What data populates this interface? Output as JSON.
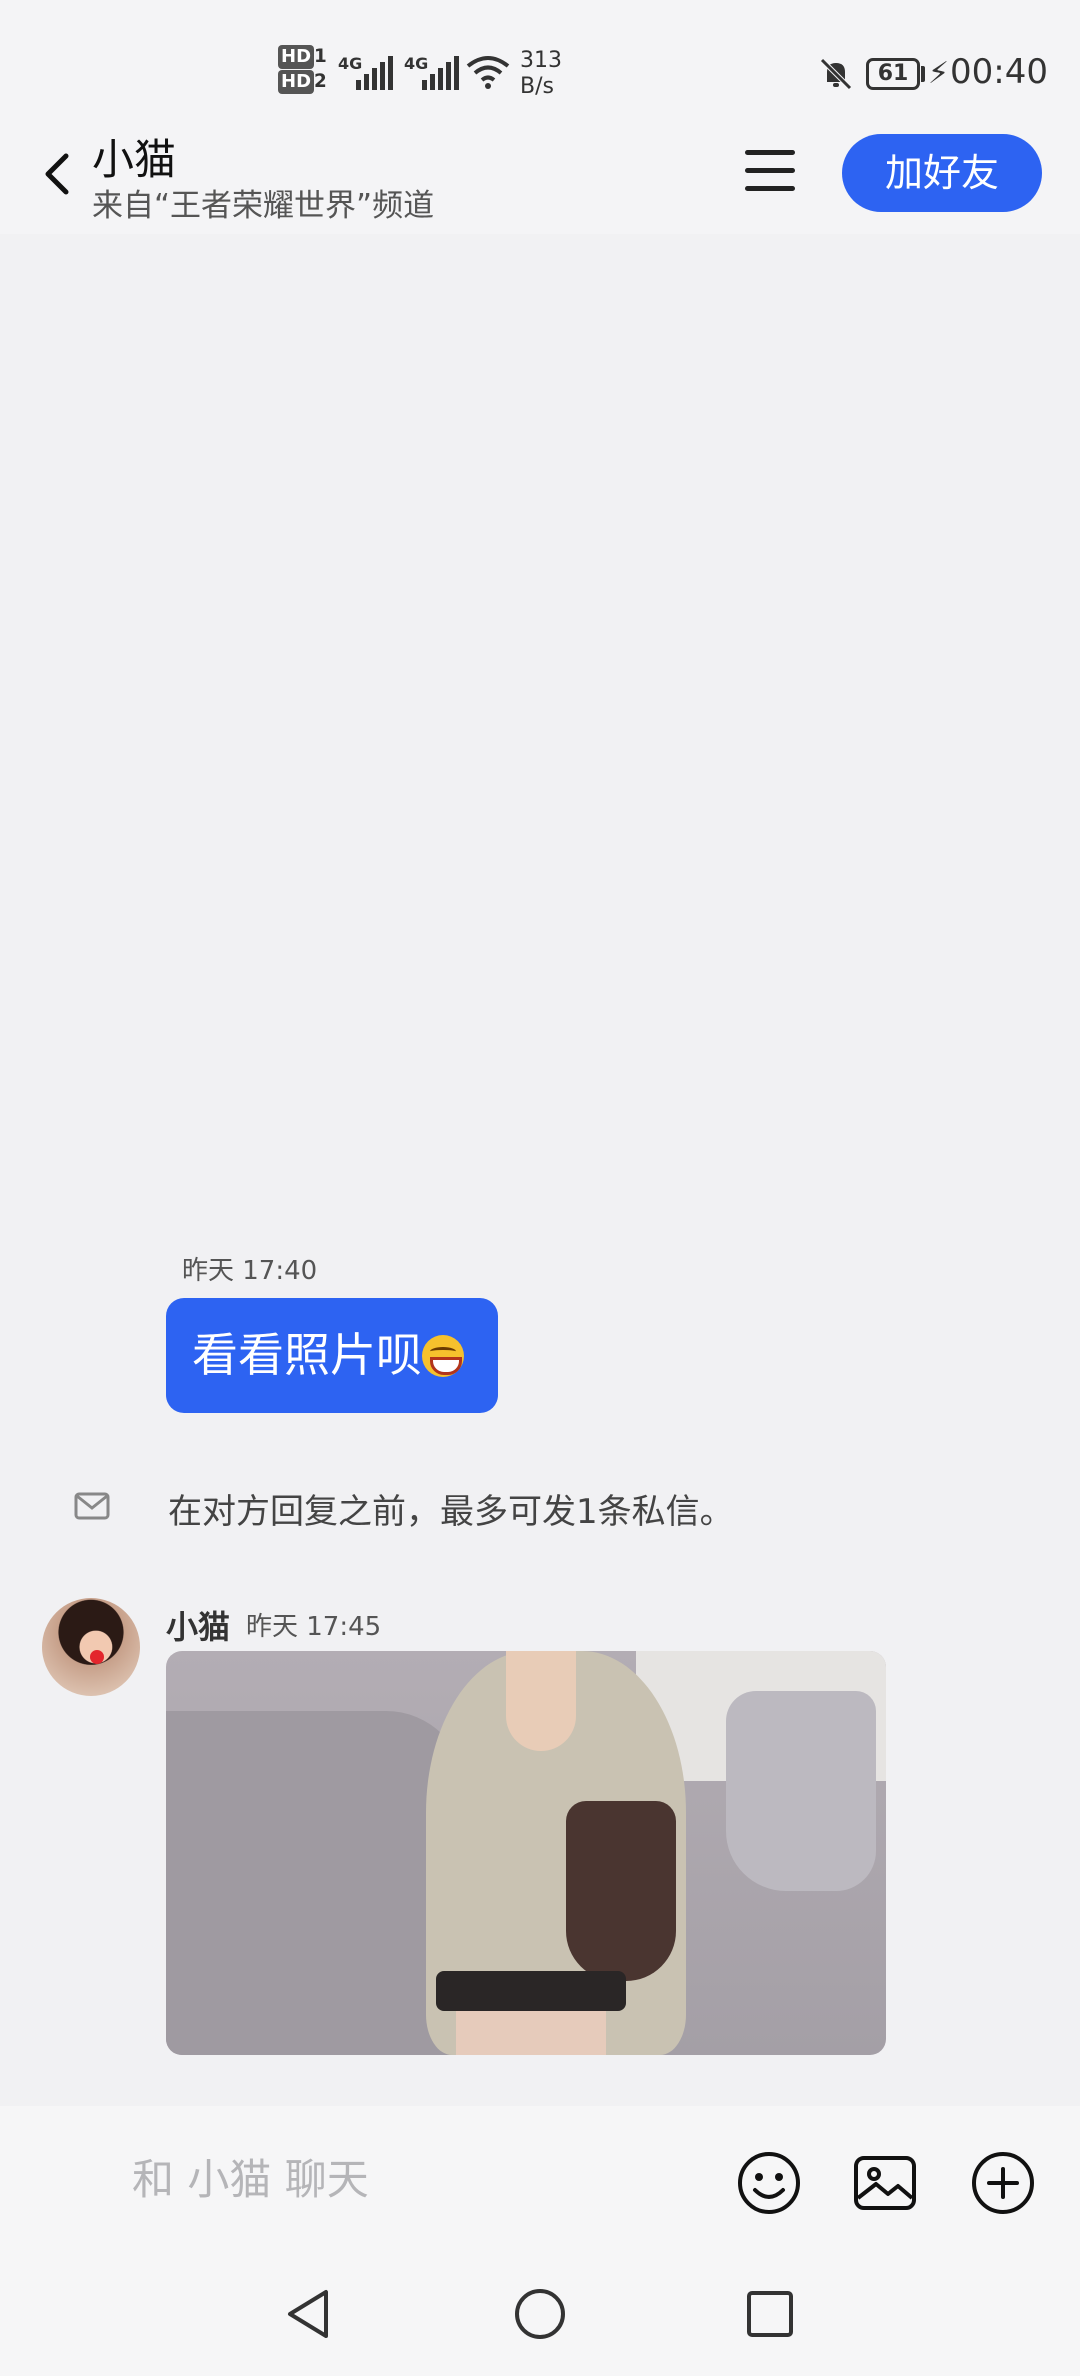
{
  "status_bar": {
    "hd1": "HD",
    "hd1_sub": "1",
    "hd2": "HD",
    "hd2_sub": "2",
    "net1": "4G",
    "net2": "4G",
    "speed_value": "313",
    "speed_unit": "B/s",
    "battery": "61",
    "time": "00:40"
  },
  "header": {
    "title": "小猫",
    "subtitle": "来自“王者荣耀世界”频道",
    "add_friend_label": "加好友"
  },
  "messages": {
    "outgoing_time": "昨天 17:40",
    "outgoing_text": "看看照片呗",
    "notice": "在对方回复之前，最多可发1条私信。",
    "incoming_name": "小猫",
    "incoming_time": "昨天 17:45"
  },
  "input": {
    "placeholder": "和 小猫 聊天"
  },
  "colors": {
    "accent": "#2d63f2",
    "background": "#f1f1f3"
  },
  "icons": [
    "back-icon",
    "menu-icon",
    "mail-icon",
    "emoji-icon",
    "image-icon",
    "plus-icon",
    "nav-back-icon",
    "nav-home-icon",
    "nav-recent-icon"
  ]
}
